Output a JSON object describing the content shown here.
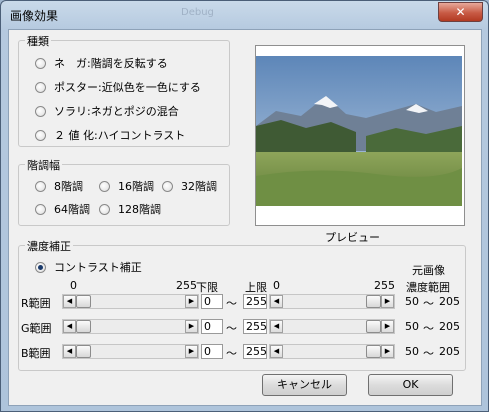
{
  "window": {
    "title": "画像効果",
    "close_glyph": "✕",
    "background_title": "Debug"
  },
  "type_group": {
    "legend": "種類",
    "options": [
      "ネ　ガ:階調を反転する",
      "ポスター:近似色を一色にする",
      "ソラリ:ネガとポジの混合",
      "２ 値 化:ハイコントラスト"
    ]
  },
  "gradation_group": {
    "legend": "階調幅",
    "options": [
      "8階調",
      "16階調",
      "32階調",
      "64階調",
      "128階調"
    ]
  },
  "preview": {
    "caption": "プレビュー"
  },
  "density_group": {
    "legend": "濃度補正",
    "contrast_label": "コントラスト補正",
    "lower_header": "下限",
    "upper_header": "上限",
    "original_header_1": "元画像",
    "original_header_2": "濃度範囲",
    "scale_min": "0",
    "scale_max": "255",
    "tilde": "〜",
    "rows": [
      {
        "label": "R範囲",
        "lower": "0",
        "upper": "255",
        "orig_min": "50",
        "orig_max": "205"
      },
      {
        "label": "G範囲",
        "lower": "0",
        "upper": "255",
        "orig_min": "50",
        "orig_max": "205"
      },
      {
        "label": "B範囲",
        "lower": "0",
        "upper": "255",
        "orig_min": "50",
        "orig_max": "205"
      }
    ]
  },
  "buttons": {
    "cancel": "キャンセル",
    "ok": "OK"
  }
}
